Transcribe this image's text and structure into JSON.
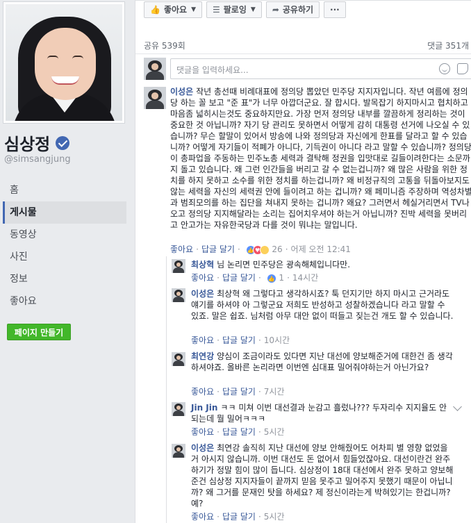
{
  "profile": {
    "name": "심상정",
    "handle": "@simsangjung"
  },
  "nav": {
    "items": [
      "홈",
      "게시물",
      "동영상",
      "사진",
      "정보",
      "좋아요"
    ],
    "active": "게시물",
    "create_page": "페이지 만들기"
  },
  "actions": {
    "like": "좋아요",
    "follow": "팔로잉",
    "share": "공유하기",
    "more": "···"
  },
  "stats": {
    "shares": "공유 539회",
    "comments": "댓글 351개"
  },
  "composer": {
    "placeholder": "댓글을 입력하세요..."
  },
  "comments": [
    {
      "author": "이성은",
      "text": "작년 총선때 비례대표에 정의당 뽑았던 민주당 지지자입니다. 작년 여름에 정의당 하는 꼴 보고 \"준 표\"가 너무 아깝더군요. 잘 합시다. 발목잡기 하지마시고 협치하고 마음좀 넓히시는것도 중요하지만요. 가장 먼저 정의당 내부를 깔끔하게 정리하는 것이 중요한 것 아닙니까? 자기 당 관리도 못하면서 어떻게 감히 대통령 선거에 나오실 수 있습니까? 무슨 할말이 있어서 방송에 나와 정의당과 자신에게 한표를 달라고 할 수 있습니까? 어떻게 자기들이 적폐가 아니다, 기득권이 아니다 라고 말할 수 있습니까? 정의당이 총파업을 주동하는 민주노총 세력과 결탁해 정권을 입맛대로 길들이려한다는 소문까지 돌고 있습니다. 왜 그런 인간들을 버리고 갈 수 없는겁니까? 왜 많은 사람을 위한 정치를 하지 못하고 소수를 위한 정치를 하는겁니까? 왜 비정규직의 고통을 뒤돌아보지도 않는 세력을 자신의 세력권 안에 들이려고 하는 겁니까? 왜 페미니즘 주장하며 역성차별과 범죄모의를 하는 집단을 쳐내지 못하는 겁니까? 왜요? 그러면서 헤실거리면서 TV나오고 정의당 지지해달라는 소리는 집어치우셔야 하는거 아닙니까? 진박 세력을 못버리고 안고가는 자유한국당과 다를 것이 뭐냐는 말입니다.",
      "like": "좋아요",
      "reply": "답글 달기",
      "reactions": "26",
      "time": "어제 오전 12:41"
    },
    {
      "author": "최상혁",
      "text": "님 논리면 민주당은 광속해체입니다만.",
      "like": "좋아요",
      "reply": "답글 달기",
      "reactions": "1",
      "time": "14시간"
    },
    {
      "author": "이성은",
      "text": "최상혁 왜 그렇다고 생각하시죠? 툭 던지기만 하지 마시고 근거라도 얘기를 하셔야 아 그렇군요 저희도 반성하고 성찰하겠습니다 라고 말할 수 있죠. 말은 쉽죠. 님처럼 아무 대안 없이 떠들고 짖는건 개도 할 수 있습니다.",
      "like": "좋아요",
      "reply": "답글 달기",
      "time": "10시간"
    },
    {
      "author": "최연강",
      "text": "양심이 조금이라도 있다면 지난 대선에 양보해준거에 대한건 좀 생각하셔야죠. 올바른 논리라면 이번엔 심대표 밀어줘야하는거 아닌가요?",
      "like": "좋아요",
      "reply": "답글 달기",
      "time": "7시간"
    },
    {
      "author": "Jin Jin",
      "text": "ㅋㅋ 미쳐 이번 대선결과 눈감고 흘렀나??? 두자리수 지지율도 안되는데 뭘 밀어ㅋㅋㅋ",
      "like": "좋아요",
      "reply": "답글 달기",
      "time": "5시간"
    },
    {
      "author": "이성은",
      "text": "최연강 솔직히 지난 대선에 양보 안해줬어도 어차피 별 영향 없었을 거 아시지 않습니까. 이번 대선도 돈 없어서 힘들었잖아요. 대선이란건 완주하기가 정말 힘이 많이 듭니다. 심상정이 18대 대선에서 완주 못하고 양보해준건 심상정 지지자들이 끝까지 믿음 못주고 밀어주지 못했기 때문이 아닙니까? 왜 그거를 문재인 탓을 하세요? 제 정신이라는게 박혀있기는 한겁니까? 예?",
      "like": "좋아요",
      "reply": "답글 달기",
      "time": "5시간"
    }
  ],
  "icons": {
    "like_action": "thumbs-up-icon",
    "follow_action": "rss-icon",
    "share_action": "share-arrow-icon",
    "emoji": "smiley-icon",
    "sticker": "sticker-icon",
    "verified": "verified-badge-icon"
  },
  "colors": {
    "link": "#385898",
    "accent": "#4267b2",
    "create_button": "#42b72a"
  }
}
